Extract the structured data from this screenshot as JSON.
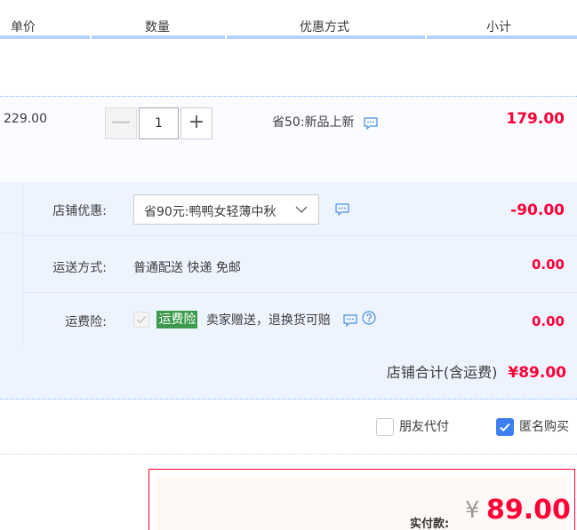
{
  "header": {
    "unit_price": "单价",
    "quantity": "数量",
    "promo_method": "优惠方式",
    "subtotal": "小计"
  },
  "item": {
    "unit_price": "229.00",
    "quantity": "1",
    "minus_label": "—",
    "plus_label": "+",
    "promo_text": "省50:新品上新",
    "subtotal": "179.00"
  },
  "shop": {
    "discount_label": "店铺优惠:",
    "discount_selected": "省90元:鸭鸭女轻薄中秋",
    "discount_amount": "-90.00",
    "shipping_label": "运送方式:",
    "shipping_value": "普通配送 快递 免邮",
    "shipping_amount": "0.00",
    "insurance_label": "运费险:",
    "insurance_tag": "运费险",
    "insurance_text": "卖家赠送，退换货可赔",
    "insurance_amount": "0.00",
    "total_label": "店铺合计(含运费)",
    "total_amount": "¥89.00"
  },
  "options": {
    "friend_pay": "朋友代付",
    "friend_pay_checked": false,
    "anonymous": "匿名购买",
    "anonymous_checked": true
  },
  "payment": {
    "label": "实付款:",
    "currency": "¥",
    "amount": "89.00"
  },
  "colors": {
    "accent_red": "#ff0036",
    "header_line": "#b2d1ff",
    "checkbox_blue": "#3d7ff0",
    "insurance_green": "#3c9a4c"
  }
}
